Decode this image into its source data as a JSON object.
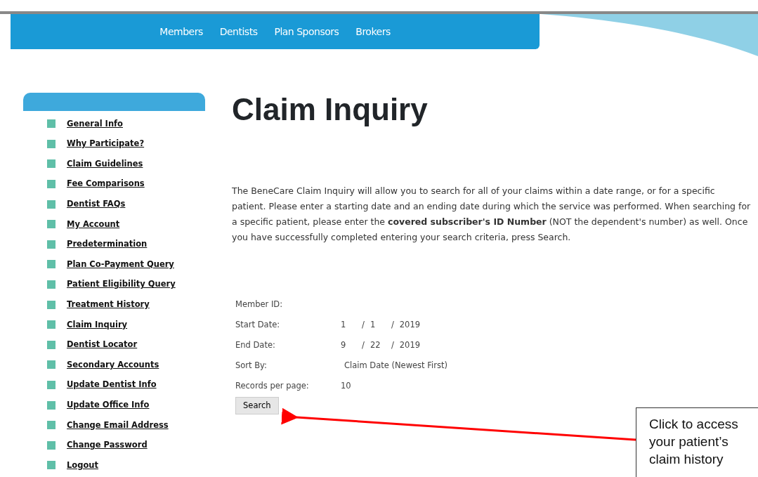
{
  "top_nav": {
    "items": [
      {
        "label": "Members"
      },
      {
        "label": "Dentists"
      },
      {
        "label": "Plan Sponsors"
      },
      {
        "label": "Brokers"
      }
    ]
  },
  "sidebar": {
    "items": [
      {
        "label": "General Info"
      },
      {
        "label": "Why Participate?"
      },
      {
        "label": "Claim Guidelines"
      },
      {
        "label": "Fee Comparisons"
      },
      {
        "label": "Dentist FAQs"
      },
      {
        "label": "My Account"
      },
      {
        "label": "Predetermination"
      },
      {
        "label": "Plan Co-Payment Query"
      },
      {
        "label": "Patient Eligibility Query"
      },
      {
        "label": "Treatment History"
      },
      {
        "label": "Claim Inquiry"
      },
      {
        "label": "Dentist Locator"
      },
      {
        "label": "Secondary Accounts"
      },
      {
        "label": "Update Dentist Info"
      },
      {
        "label": "Update Office Info"
      },
      {
        "label": "Change Email Address"
      },
      {
        "label": "Change Password"
      },
      {
        "label": "Logout"
      }
    ]
  },
  "page": {
    "title": "Claim Inquiry",
    "intro": "The BeneCare Claim Inquiry will allow you to search for all of your claims within a date range, or for a specific patient. Please enter a starting date and an ending date during which the service was performed. When searching for a specific patient, please enter the **covered subscriber's ID Number** (NOT the dependent's number) as well. Once you have successfully completed entering your search criteria, press Search."
  },
  "form": {
    "fields": [
      {
        "kind": "text",
        "label": "Member ID:"
      },
      {
        "kind": "date",
        "label": "Start Date:",
        "parts": [
          "1",
          "1",
          "2019"
        ],
        "separators": [
          "/",
          "/"
        ]
      },
      {
        "kind": "date",
        "label": "End Date:",
        "parts": [
          "9",
          "22",
          "2019"
        ],
        "separators": [
          "/",
          "/"
        ]
      },
      {
        "kind": "select",
        "label": "Sort By:",
        "value": "Claim Date (Newest First)"
      },
      {
        "kind": "text",
        "label": "Records per page:",
        "value": "10"
      }
    ],
    "button": "Search"
  },
  "callout": {
    "text": "Click to access your patient’s claim history"
  }
}
